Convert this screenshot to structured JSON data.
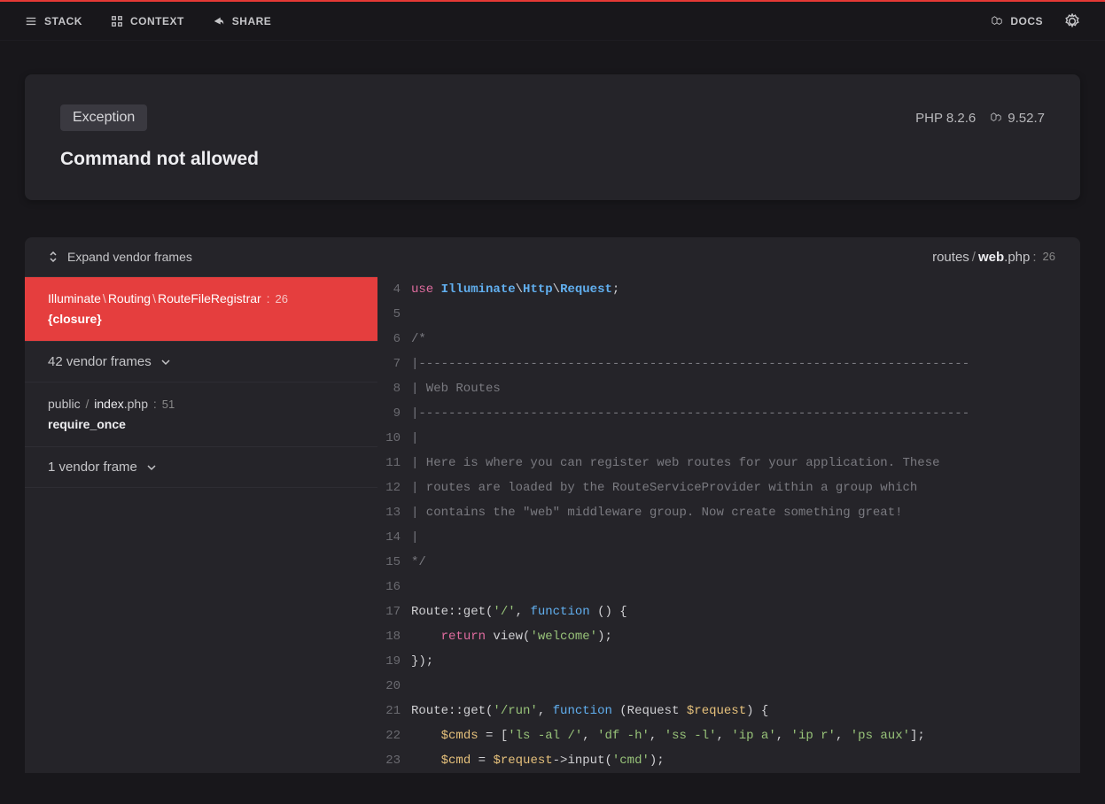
{
  "nav": {
    "stack": "STACK",
    "context": "CONTEXT",
    "share": "SHARE",
    "docs": "DOCS"
  },
  "error": {
    "badge": "Exception",
    "php": "PHP 8.2.6",
    "laravel": "9.52.7",
    "message": "Command not allowed"
  },
  "sidebar": {
    "expand": "Expand vendor frames",
    "active": {
      "ns1": "Illuminate",
      "ns2": "Routing",
      "ns3": "RouteFileRegistrar",
      "line": "26",
      "closure": "{closure}"
    },
    "vframes1": "42 vendor frames",
    "frame2": {
      "dir": "public",
      "file_base": "index",
      "file_ext": ".php",
      "line": "51",
      "fn": "require_once"
    },
    "vframes2": "1 vendor frame"
  },
  "code": {
    "path_dir": "routes",
    "path_file": "web",
    "path_ext": ".php",
    "path_line": "26",
    "lines": [
      {
        "n": "4",
        "html": "<span class='k-use'>use</span> <span class='k-ns'>Illuminate</span>\\<span class='k-ns'>Http</span>\\<span class='k-ns'>Request</span>;"
      },
      {
        "n": "5",
        "html": ""
      },
      {
        "n": "6",
        "html": "<span class='k-cmt'>/*</span>"
      },
      {
        "n": "7",
        "html": "<span class='k-cmt'>|--------------------------------------------------------------------------</span>"
      },
      {
        "n": "8",
        "html": "<span class='k-cmt'>| Web Routes</span>"
      },
      {
        "n": "9",
        "html": "<span class='k-cmt'>|--------------------------------------------------------------------------</span>"
      },
      {
        "n": "10",
        "html": "<span class='k-cmt'>|</span>"
      },
      {
        "n": "11",
        "html": "<span class='k-cmt'>| Here is where you can register web routes for your application. These</span>"
      },
      {
        "n": "12",
        "html": "<span class='k-cmt'>| routes are loaded by the RouteServiceProvider within a group which</span>"
      },
      {
        "n": "13",
        "html": "<span class='k-cmt'>| contains the \"web\" middleware group. Now create something great!</span>"
      },
      {
        "n": "14",
        "html": "<span class='k-cmt'>|</span>"
      },
      {
        "n": "15",
        "html": "<span class='k-cmt'>*/</span>"
      },
      {
        "n": "16",
        "html": ""
      },
      {
        "n": "17",
        "html": "Route::get(<span class='k-str'>'/'</span>, <span class='k-fn'>function</span> () {"
      },
      {
        "n": "18",
        "html": "    <span class='k-ret'>return</span> view(<span class='k-str'>'welcome'</span>);"
      },
      {
        "n": "19",
        "html": "});"
      },
      {
        "n": "20",
        "html": ""
      },
      {
        "n": "21",
        "html": "Route::get(<span class='k-str'>'/run'</span>, <span class='k-fn'>function</span> (Request <span class='k-var'>$request</span>) {"
      },
      {
        "n": "22",
        "html": "    <span class='k-var'>$cmds</span> = [<span class='k-str'>'ls -al /'</span>, <span class='k-str'>'df -h'</span>, <span class='k-str'>'ss -l'</span>, <span class='k-str'>'ip a'</span>, <span class='k-str'>'ip r'</span>, <span class='k-str'>'ps aux'</span>];"
      },
      {
        "n": "23",
        "html": "    <span class='k-var'>$cmd</span> = <span class='k-var'>$request</span>-&gt;input(<span class='k-str'>'cmd'</span>);"
      }
    ]
  }
}
